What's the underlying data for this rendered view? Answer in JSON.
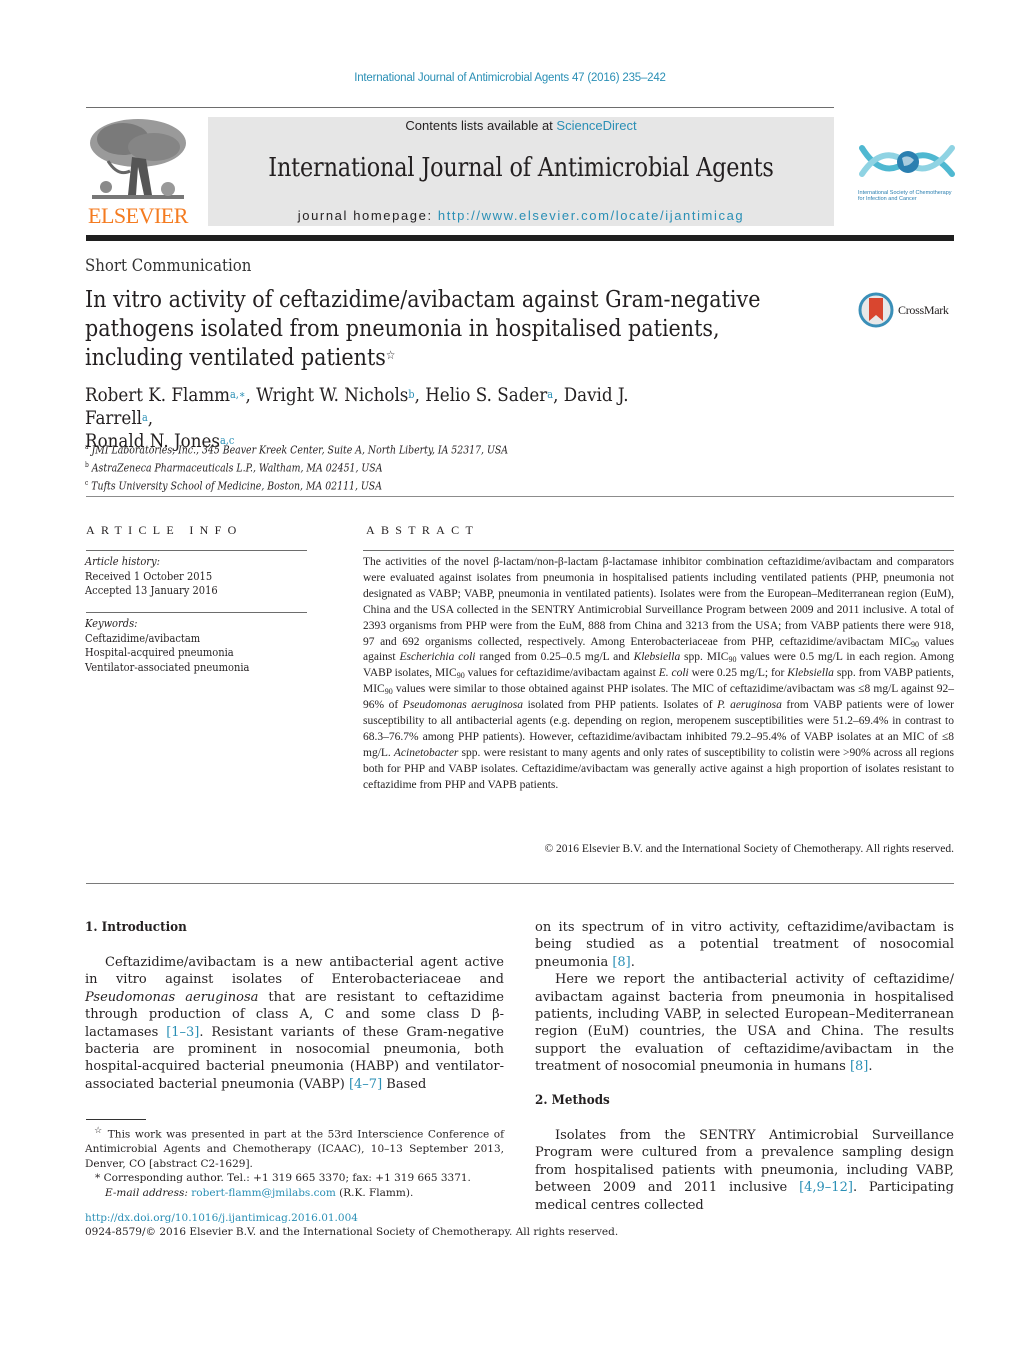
{
  "header": {
    "journal_ref": "International Journal of Antimicrobial Agents 47 (2016) 235–242",
    "publisher_logo_text": "ELSEVIER",
    "contents_prefix": "Contents lists available at ",
    "contents_link": "ScienceDirect",
    "journal_title": "International Journal of Antimicrobial Agents",
    "homepage_prefix": "journal homepage: ",
    "homepage_link": "http://www.elsevier.com/locate/ijantimicag",
    "society_logo_line1": "International Society of Chemotherapy",
    "society_logo_line2": "for Infection and Cancer",
    "colors": {
      "link": "#2a8fb5",
      "elsevier_orange": "#f47b20",
      "society_teal": "#4fb8d1"
    }
  },
  "article": {
    "type": "Short Communication",
    "title": "In vitro activity of ceftazidime/avibactam against Gram-negative pathogens isolated from pneumonia in hospitalised patients, including ventilated patients",
    "title_mark": "☆",
    "crossmark_label": "CrossMark",
    "authors": [
      {
        "name": "Robert K. Flamm",
        "sup": "a,∗",
        "sep": ", "
      },
      {
        "name": "Wright W. Nichols",
        "sup": "b",
        "sep": ", "
      },
      {
        "name": "Helio S. Sader",
        "sup": "a",
        "sep": ", "
      },
      {
        "name": "David J. Farrell",
        "sup": "a",
        "sep": ","
      },
      {
        "name": "Ronald N. Jones",
        "sup": "a,c",
        "sep": ""
      }
    ],
    "affiliations": [
      {
        "mark": "a",
        "text": "JMI Laboratories, Inc., 345 Beaver Kreek Center, Suite A, North Liberty, IA 52317, USA"
      },
      {
        "mark": "b",
        "text": "AstraZeneca Pharmaceuticals L.P., Waltham, MA 02451, USA"
      },
      {
        "mark": "c",
        "text": "Tufts University School of Medicine, Boston, MA 02111, USA"
      }
    ]
  },
  "article_info": {
    "heading": "ARTICLE INFO",
    "history_label": "Article history:",
    "received": "Received 1 October 2015",
    "accepted": "Accepted 13 January 2016",
    "keywords_label": "Keywords:",
    "keywords": [
      "Ceftazidime/avibactam",
      "Hospital-acquired pneumonia",
      "Ventilator-associated pneumonia"
    ]
  },
  "abstract": {
    "heading": "ABSTRACT",
    "parts": [
      "The activities of the novel β-lactam/non-β-lactam β-lactamase inhibitor combination ceftazidime/avibactam and comparators were evaluated against isolates from pneumonia in hospitalised patients including ventilated patients (PHP, pneumonia not designated as VABP; VABP, pneumonia in ventilated patients). Isolates were from the European–Mediterranean region (EuM), China and the USA collected in the SENTRY Antimicrobial Surveillance Program between 2009 and 2011 inclusive. A total of 2393 organisms from PHP were from the EuM, 888 from China and 3213 from the USA; from VABP patients there were 918, 97 and 692 organisms collected, respectively. Among Enterobacteriaceae from PHP, ceftazidime/avibactam MIC",
      "90",
      " values against ",
      "Escherichia coli",
      " ranged from 0.25–0.5 mg/L and ",
      "Klebsiella",
      " spp. MIC",
      "90",
      " values were 0.5 mg/L in each region. Among VABP isolates, MIC",
      "90",
      " values for ceftazidime/avibactam against ",
      "E. coli",
      " were 0.25 mg/L; for ",
      "Klebsiella",
      " spp. from VABP patients, MIC",
      "90",
      " values were similar to those obtained against PHP isolates. The MIC of ceftazidime/avibactam was ≤8 mg/L against 92–96% of ",
      "Pseudomonas aeruginosa",
      " isolated from PHP patients. Isolates of ",
      "P. aeruginosa",
      " from VABP patients were of lower susceptibility to all antibacterial agents (e.g. depending on region, meropenem susceptibilities were 51.2–69.4% in contrast to 68.3–76.7% among PHP patients). However, ceftazidime/avibactam inhibited 79.2–95.4% of VABP isolates at an MIC of ≤8 mg/L. ",
      "Acinetobacter",
      " spp. were resistant to many agents and only rates of susceptibility to colistin were >90% across all regions both for PHP and VABP isolates. Ceftazidime/avibactam was generally active against a high proportion of isolates resistant to ceftazidime from PHP and VAPB patients."
    ],
    "copyright": "© 2016 Elsevier B.V. and the International Society of Chemotherapy. All rights reserved."
  },
  "intro": {
    "heading": "1.  Introduction",
    "p1": [
      "Ceftazidime/avibactam is a new antibacterial agent active in vitro against isolates of Enterobacteriaceae and ",
      "Pseudomonas aeruginosa",
      " that are resistant to ceftazidime through production of class A, C and some class D β-lactamases ",
      "[1–3]",
      ". Resistant variants of these Gram-negative bacteria are prominent in nosocomial pneumonia, both hospital-acquired bacterial pneumonia (HABP) and ventilator-associated bacterial pneumonia (VABP) ",
      "[4–7]",
      ". Based on its spectrum of in vitro activity, ceftazidime/avibactam is being studied as a potential treatment of nosocomial pneumonia ",
      "[8]",
      "."
    ],
    "p2": [
      "Here we report the antibacterial activity of ceftazidime/ avibactam against bacteria from pneumonia in hospitalised patients, including VABP, in selected European–Mediterranean region (EuM) countries, the USA and China. The results support the evaluation of ceftazidime/avibactam in the treatment of nosocomial pneumonia in humans ",
      "[8]",
      "."
    ]
  },
  "methods": {
    "heading": "2.  Methods",
    "p1": [
      "Isolates from the SENTRY Antimicrobial Surveillance Program were cultured from a prevalence sampling design from hospitalised patients with pneumonia, including VABP, between 2009 and 2011 inclusive ",
      "[4,9–12]",
      ". Participating medical centres collected"
    ]
  },
  "footnotes": {
    "star_mark": "☆",
    "star_text": "This work was presented in part at the 53rd Interscience Conference of Antimicrobial Agents and Chemotherapy (ICAAC), 10–13 September 2013, Denver, CO [abstract C2-1629].",
    "corr_mark": "*",
    "corr_text": "Corresponding author. Tel.: +1 319 665 3370; fax: +1 319 665 3371.",
    "email_label": "E-mail address:",
    "email": "robert-flamm@jmilabs.com",
    "email_suffix": " (R.K. Flamm)."
  },
  "footer": {
    "doi": "http://dx.doi.org/10.1016/j.ijantimicag.2016.01.004",
    "issn_line": "0924-8579/© 2016 Elsevier B.V. and the International Society of Chemotherapy. All rights reserved."
  }
}
